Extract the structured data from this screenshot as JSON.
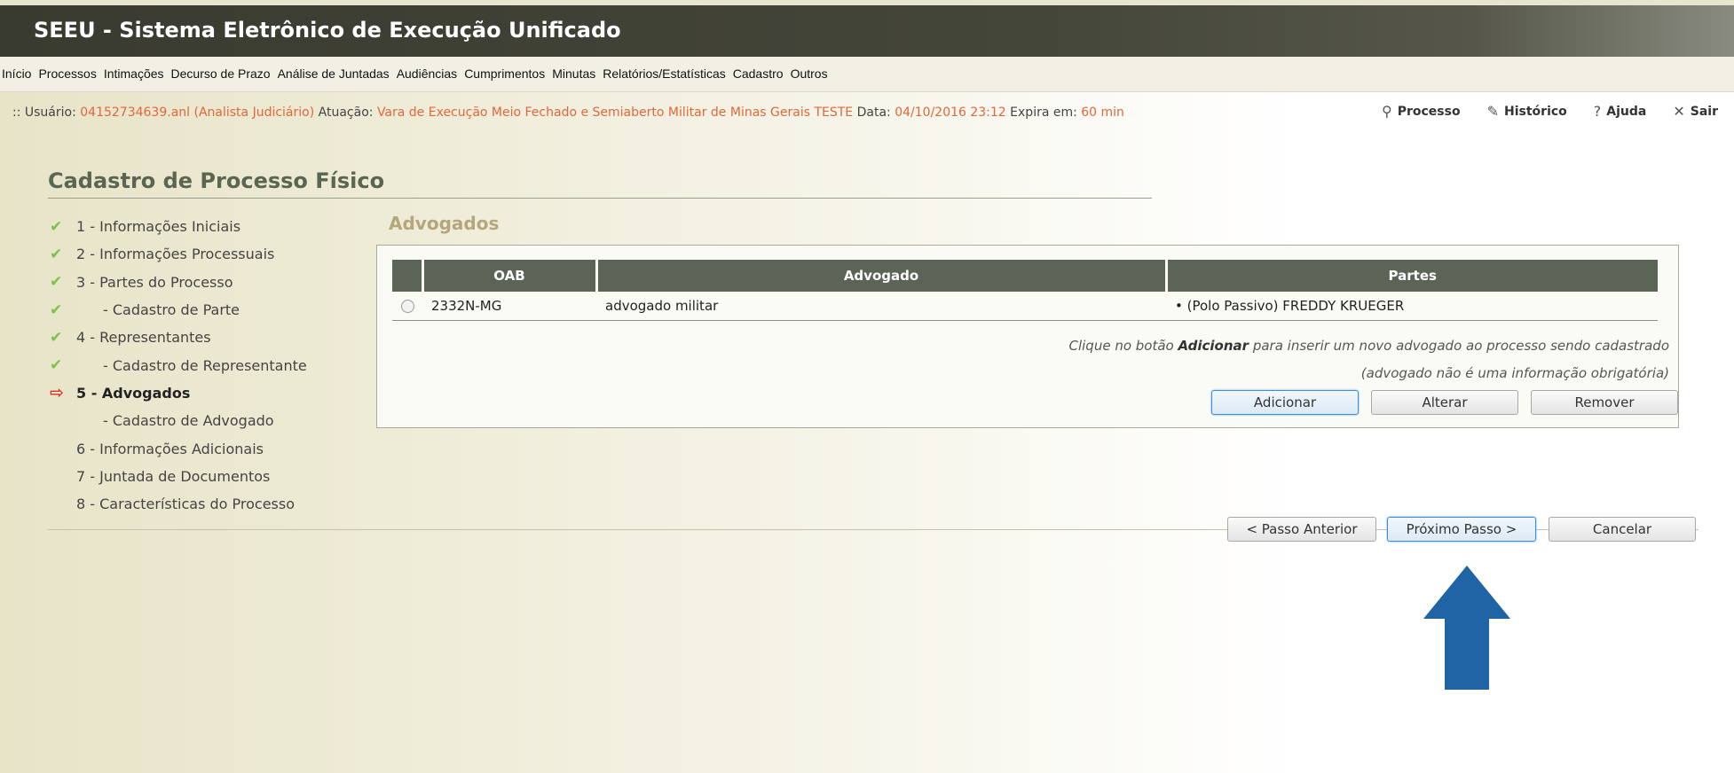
{
  "app": {
    "title": "SEEU - Sistema Eletrônico de Execução Unificado"
  },
  "menu": [
    "Início",
    "Processos",
    "Intimações",
    "Decurso de Prazo",
    "Análise de Juntadas",
    "Audiências",
    "Cumprimentos",
    "Minutas",
    "Relatórios/Estatísticas",
    "Cadastro",
    "Outros"
  ],
  "user_info": {
    "prefix": ":: Usuário:",
    "user": "04152734639.anl (Analista Judiciário)",
    "atuacao_label": "Atuação:",
    "atuacao": "Vara de Execução Meio Fechado e Semiaberto Militar de Minas Gerais TESTE",
    "data_label": "Data:",
    "data": "04/10/2016 23:12",
    "expira_label": "Expira em:",
    "expira": "60 min"
  },
  "top_links": {
    "processo": "Processo",
    "historico": "Histórico",
    "ajuda": "Ajuda",
    "sair": "Sair"
  },
  "page_title": "Cadastro de Processo Físico",
  "steps": [
    {
      "label": "1 - Informações Iniciais",
      "status": "done"
    },
    {
      "label": "2 - Informações Processuais",
      "status": "done"
    },
    {
      "label": "3 - Partes do Processo",
      "status": "done"
    },
    {
      "label": "- Cadastro de Parte",
      "status": "done"
    },
    {
      "label": "4 - Representantes",
      "status": "done"
    },
    {
      "label": "- Cadastro de Representante",
      "status": "done"
    },
    {
      "label": "5 - Advogados",
      "status": "current"
    },
    {
      "label": "- Cadastro de Advogado",
      "status": "pending"
    },
    {
      "label": "6 - Informações Adicionais",
      "status": "pending"
    },
    {
      "label": "7 - Juntada de Documentos",
      "status": "pending"
    },
    {
      "label": "8 - Características do Processo",
      "status": "pending"
    }
  ],
  "section": {
    "title": "Advogados",
    "columns": [
      "OAB",
      "Advogado",
      "Partes"
    ],
    "rows": [
      {
        "oab": "2332N-MG",
        "advogado": "advogado militar",
        "partes": "• (Polo Passivo) FREDDY KRUEGER"
      }
    ],
    "hint_pre": "Clique no botão ",
    "hint_bold": "Adicionar",
    "hint_post": " para inserir um novo advogado ao processo sendo cadastrado",
    "hint2": "(advogado não é uma informação obrigatória)",
    "buttons": {
      "add": "Adicionar",
      "edit": "Alterar",
      "remove": "Remover"
    }
  },
  "nav_buttons": {
    "prev": "< Passo Anterior",
    "next": "Próximo Passo >",
    "cancel": "Cancelar"
  },
  "colors": {
    "accent_orange": "#e2673a",
    "header_dark": "#45463a",
    "table_header": "#5c6457",
    "annotation_arrow": "#2164a5"
  },
  "icons": {
    "check": "check-icon",
    "current": "arrow-right-icon",
    "search": "search-icon",
    "pencil": "pencil-icon",
    "help": "question-icon",
    "close": "close-icon"
  }
}
